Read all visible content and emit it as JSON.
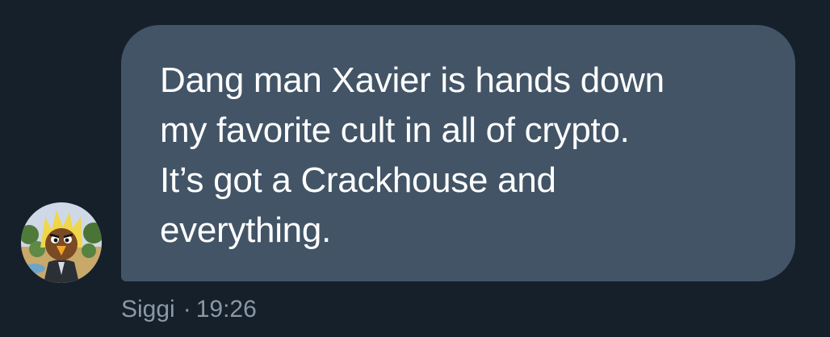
{
  "message": {
    "text": "Dang man Xavier is hands down\nmy favorite cult in all of crypto.\nIt’s got a Crackhouse and\neverything.",
    "sender": "Siggi",
    "separator": "·",
    "time": "19:26",
    "avatar_icon": "cartoon-bird-avatar-icon"
  },
  "colors": {
    "background": "#15202b",
    "bubble": "#425466",
    "text": "#ffffff",
    "meta": "#8b98a5"
  }
}
